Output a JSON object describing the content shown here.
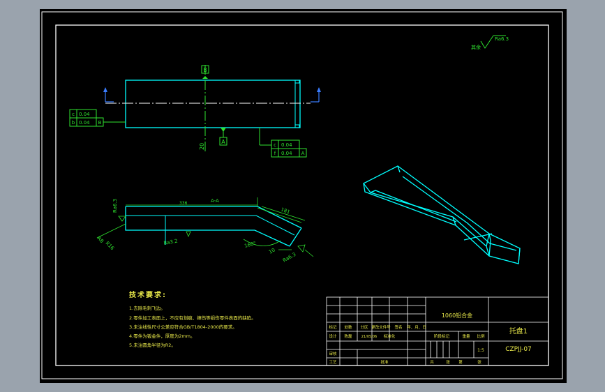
{
  "datum_labels": {
    "top": "B",
    "bottom": "A"
  },
  "dim_vertical_left": "20",
  "tolerances": {
    "left": [
      {
        "symbol": "c",
        "value": "0.04"
      },
      {
        "symbol": "b",
        "value": "0.04",
        "datum": "B"
      }
    ],
    "right": [
      {
        "symbol": "c",
        "value": "0.04"
      },
      {
        "symbol": "f",
        "value": "0.04",
        "datum": "A"
      }
    ]
  },
  "roughness_top_right": {
    "label": "其余",
    "value": "Ra6.3"
  },
  "side_view": {
    "dim_left_height": "Ra6.3",
    "dim_length": "336",
    "section": "A-A",
    "dim_slope": "181",
    "dim_r1": "R8",
    "dim_r2": "R16",
    "roughness_mid": "Ra3.2",
    "angle": "160°",
    "dim_small": "10",
    "roughness_right": "Ra6.3"
  },
  "tech_requirements": {
    "title": "技术要求:",
    "items": [
      "1.去除毛刺飞边。",
      "2.零件加工表面上，不应有划痕、擦伤等损伤零件表面的缺陷。",
      "3.未注线性尺寸公差应符合GB/T1804-2000的要求。",
      "4.零件为钣金件，厚度为2mm。",
      "5.未注圆角半径为R2。"
    ]
  },
  "title_block": {
    "material": "1060铝合金",
    "part_name": "托盘1",
    "drawing_no": "CZPJJ-07",
    "row_headers": [
      "标记",
      "处数",
      "分区",
      "更改文件号",
      "签名",
      "年、月、日"
    ],
    "design_row": [
      "设计",
      "陈磊",
      "21/05/06",
      "标准化"
    ],
    "stage_label": "阶段标记",
    "weight_label": "重量",
    "scale_label": "比例",
    "scale_value": "1:5",
    "review_label": "审核",
    "process_label": "工艺",
    "approve_label": "批准",
    "sheet_info": [
      "共",
      "张",
      "第",
      "张"
    ]
  }
}
